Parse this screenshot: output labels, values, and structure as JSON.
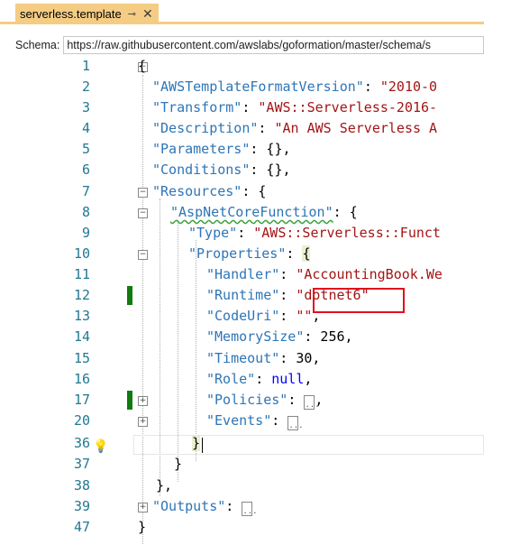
{
  "tab": {
    "filename": "serverless.template",
    "pin_glyph": "⊸",
    "close_glyph": "✕"
  },
  "schema": {
    "label": "Schema:",
    "url": "https://raw.githubusercontent.com/awslabs/goformation/master/schema/s"
  },
  "editor": {
    "line_numbers": [
      "1",
      "2",
      "3",
      "4",
      "5",
      "6",
      "7",
      "8",
      "9",
      "10",
      "11",
      "12",
      "13",
      "14",
      "15",
      "16",
      "17",
      "20",
      "36",
      "37",
      "38",
      "39",
      "47"
    ],
    "highlighted_value": "\"dotnet6\"",
    "collapsed_marker": "..."
  },
  "colors": {
    "tab_bg": "#f5cc84",
    "key_blue": "#2e75b6",
    "string_red": "#a31515",
    "line_number": "#237893",
    "highlight_box": "#e0101a",
    "change_bar": "#107c10"
  }
}
